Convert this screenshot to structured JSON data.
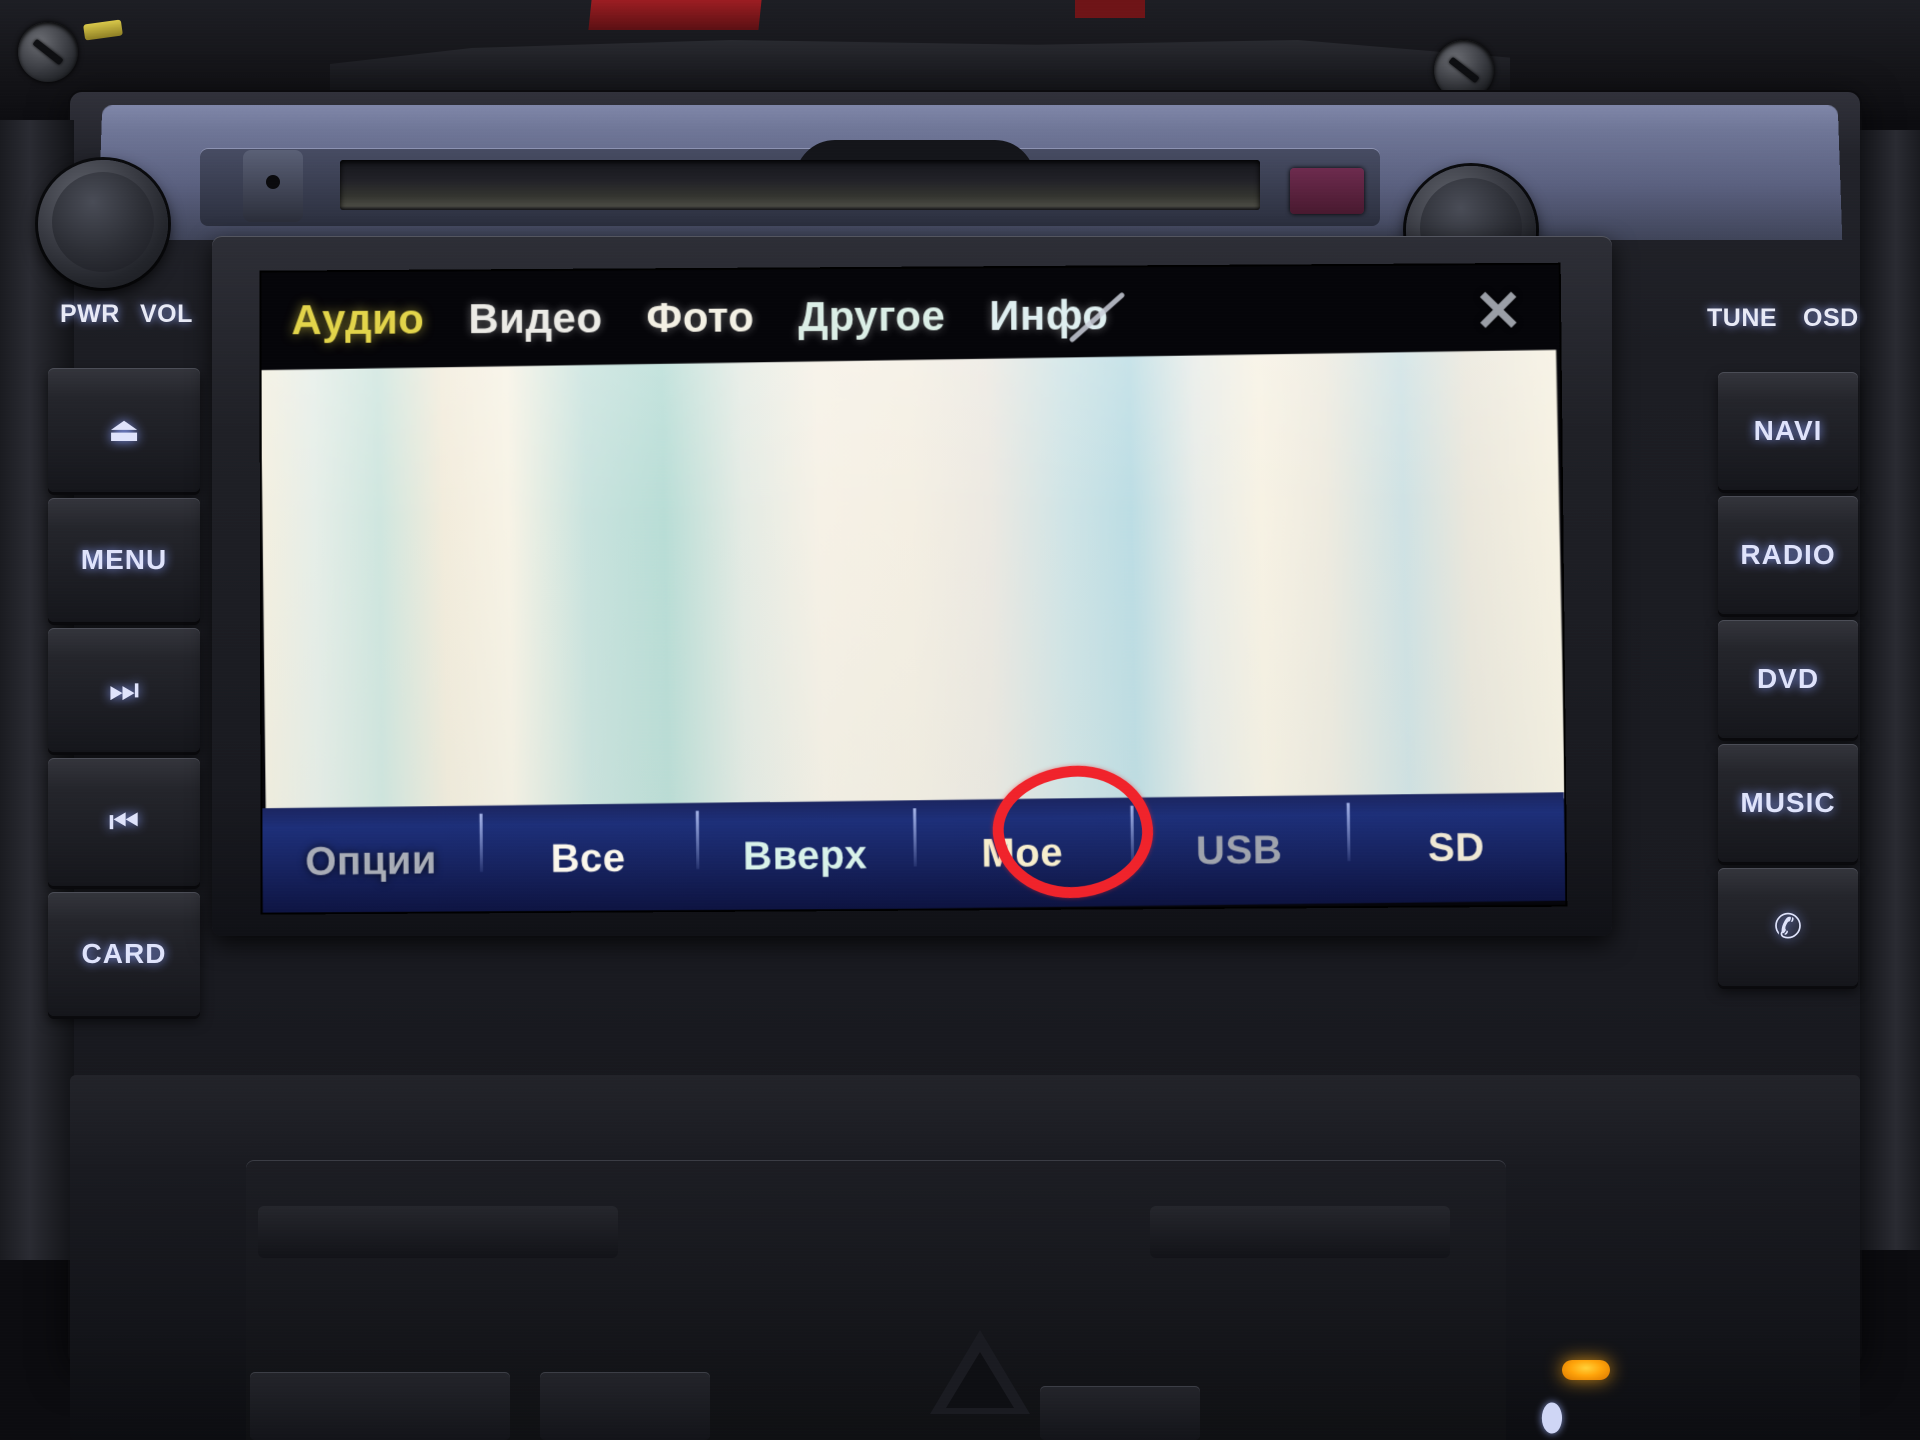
{
  "device": {
    "type": "car-head-unit",
    "screen_state": "blank-file-browser"
  },
  "hardware": {
    "left_labels": [
      {
        "name": "pwr",
        "label": "PWR"
      },
      {
        "name": "vol",
        "label": "VOL"
      }
    ],
    "right_labels": [
      {
        "name": "tune",
        "label": "TUNE"
      },
      {
        "name": "osd",
        "label": "OSD"
      }
    ],
    "left_buttons": [
      {
        "name": "eject",
        "label": "⏏",
        "kind": "glyph",
        "icon": "eject-icon"
      },
      {
        "name": "menu",
        "label": "MENU",
        "kind": "text",
        "icon": "menu-label"
      },
      {
        "name": "next",
        "label": "⏭",
        "kind": "glyph",
        "icon": "next-track-icon"
      },
      {
        "name": "prev",
        "label": "⏮",
        "kind": "glyph",
        "icon": "prev-track-icon"
      },
      {
        "name": "card",
        "label": "CARD",
        "kind": "text",
        "icon": "card-label"
      }
    ],
    "right_buttons": [
      {
        "name": "navi",
        "label": "NAVI",
        "kind": "text",
        "icon": "navi-label"
      },
      {
        "name": "radio",
        "label": "RADIO",
        "kind": "text",
        "icon": "radio-label"
      },
      {
        "name": "dvd",
        "label": "DVD",
        "kind": "text",
        "icon": "dvd-label"
      },
      {
        "name": "music",
        "label": "MUSIC",
        "kind": "text",
        "icon": "music-label"
      },
      {
        "name": "phone",
        "label": "✆",
        "kind": "glyph",
        "icon": "phone-handset-icon"
      }
    ],
    "knobs": [
      {
        "name": "power-volume-knob",
        "position": "left"
      },
      {
        "name": "tune-osd-knob",
        "position": "right"
      }
    ],
    "cd_slot": {
      "name": "cd-slot",
      "reset_pinhole": true,
      "eject_chip_color": "#6d2b4e"
    }
  },
  "screen": {
    "menu": {
      "items": [
        {
          "label": "Аудио",
          "state": "selected",
          "color": "#e2d44a"
        },
        {
          "label": "Видео",
          "state": "normal",
          "color": "#ecebe6"
        },
        {
          "label": "Фото",
          "state": "normal",
          "color": "#f3f0e4"
        },
        {
          "label": "Другое",
          "state": "normal",
          "color": "#dbeee6"
        },
        {
          "label": "Инфо",
          "state": "normal",
          "color": "#dfeff0"
        }
      ],
      "close_label": "✕",
      "close_icon": "close-icon"
    },
    "content": {
      "state": "empty",
      "note": ""
    },
    "toolbar": {
      "buttons": [
        {
          "label": "Опции",
          "name": "options",
          "state": "disabled",
          "color": "#a8acb6"
        },
        {
          "label": "Все",
          "name": "all",
          "state": "normal",
          "color": "#fbf7ec"
        },
        {
          "label": "Вверх",
          "name": "up",
          "state": "normal",
          "color": "#d8f2ea"
        },
        {
          "label": "Мое",
          "name": "mine",
          "state": "normal",
          "color": "#f7eecd"
        },
        {
          "label": "USB",
          "name": "usb",
          "state": "disabled",
          "color": "#9ea2ac",
          "annotated": true
        },
        {
          "label": "SD",
          "name": "sd",
          "state": "normal",
          "color": "#efe8d4"
        }
      ]
    }
  },
  "annotation": {
    "shape": "circle",
    "color": "#f0232b",
    "target": "USB"
  },
  "indicators": {
    "amber_led": {
      "name": "amber-indicator-led",
      "color": "#ffa40a"
    },
    "seat_icon": {
      "name": "seat-heater-icon",
      "glyph": "⬮"
    }
  }
}
